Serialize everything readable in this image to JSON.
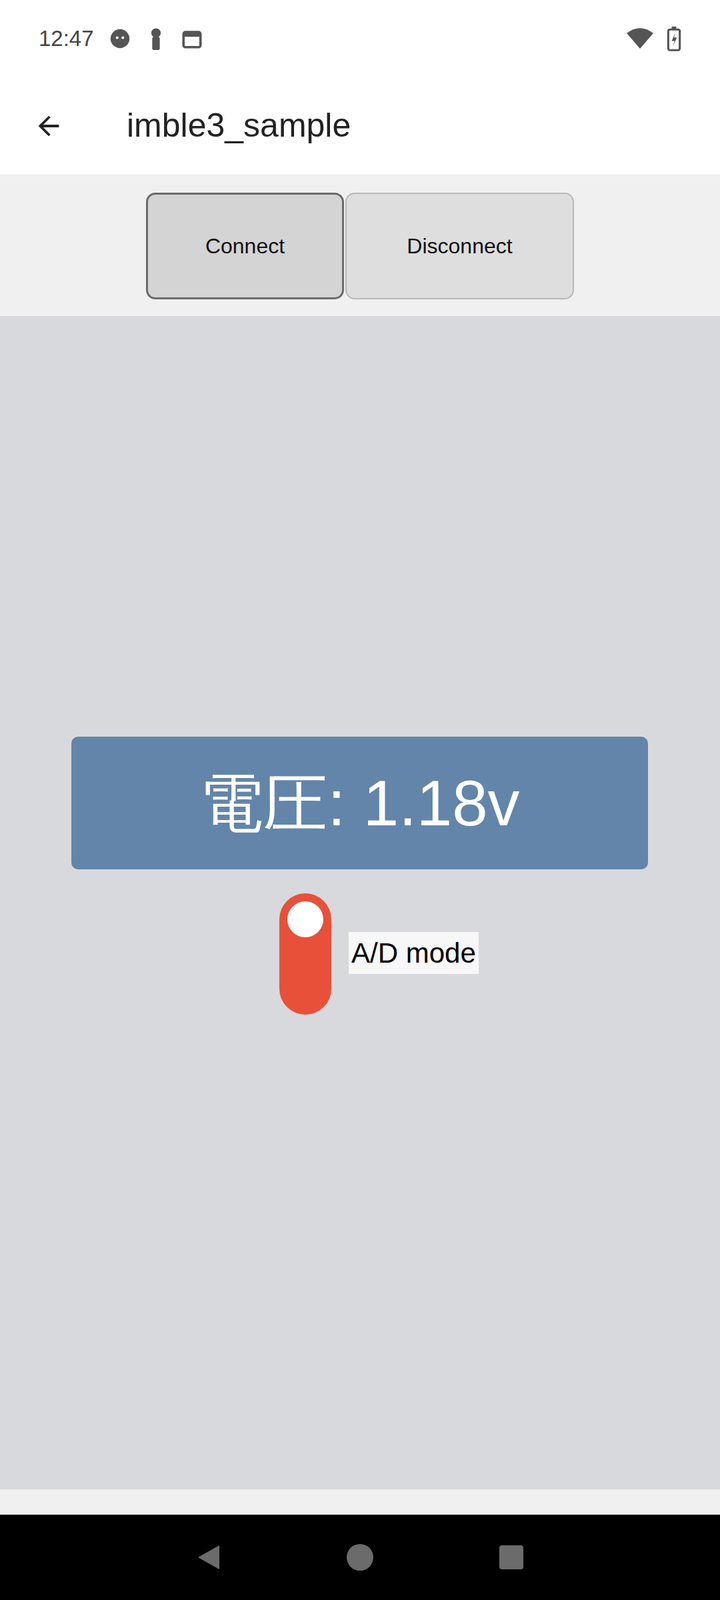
{
  "status_bar": {
    "time": "12:47"
  },
  "app_bar": {
    "title": "imble3_sample"
  },
  "buttons": [
    {
      "label": "Connect",
      "focused": true
    },
    {
      "label": "Disconnect",
      "focused": false
    }
  ],
  "voltage": {
    "text": "電圧: 1.18v"
  },
  "switch": {
    "label": "A/D mode",
    "on": true
  }
}
